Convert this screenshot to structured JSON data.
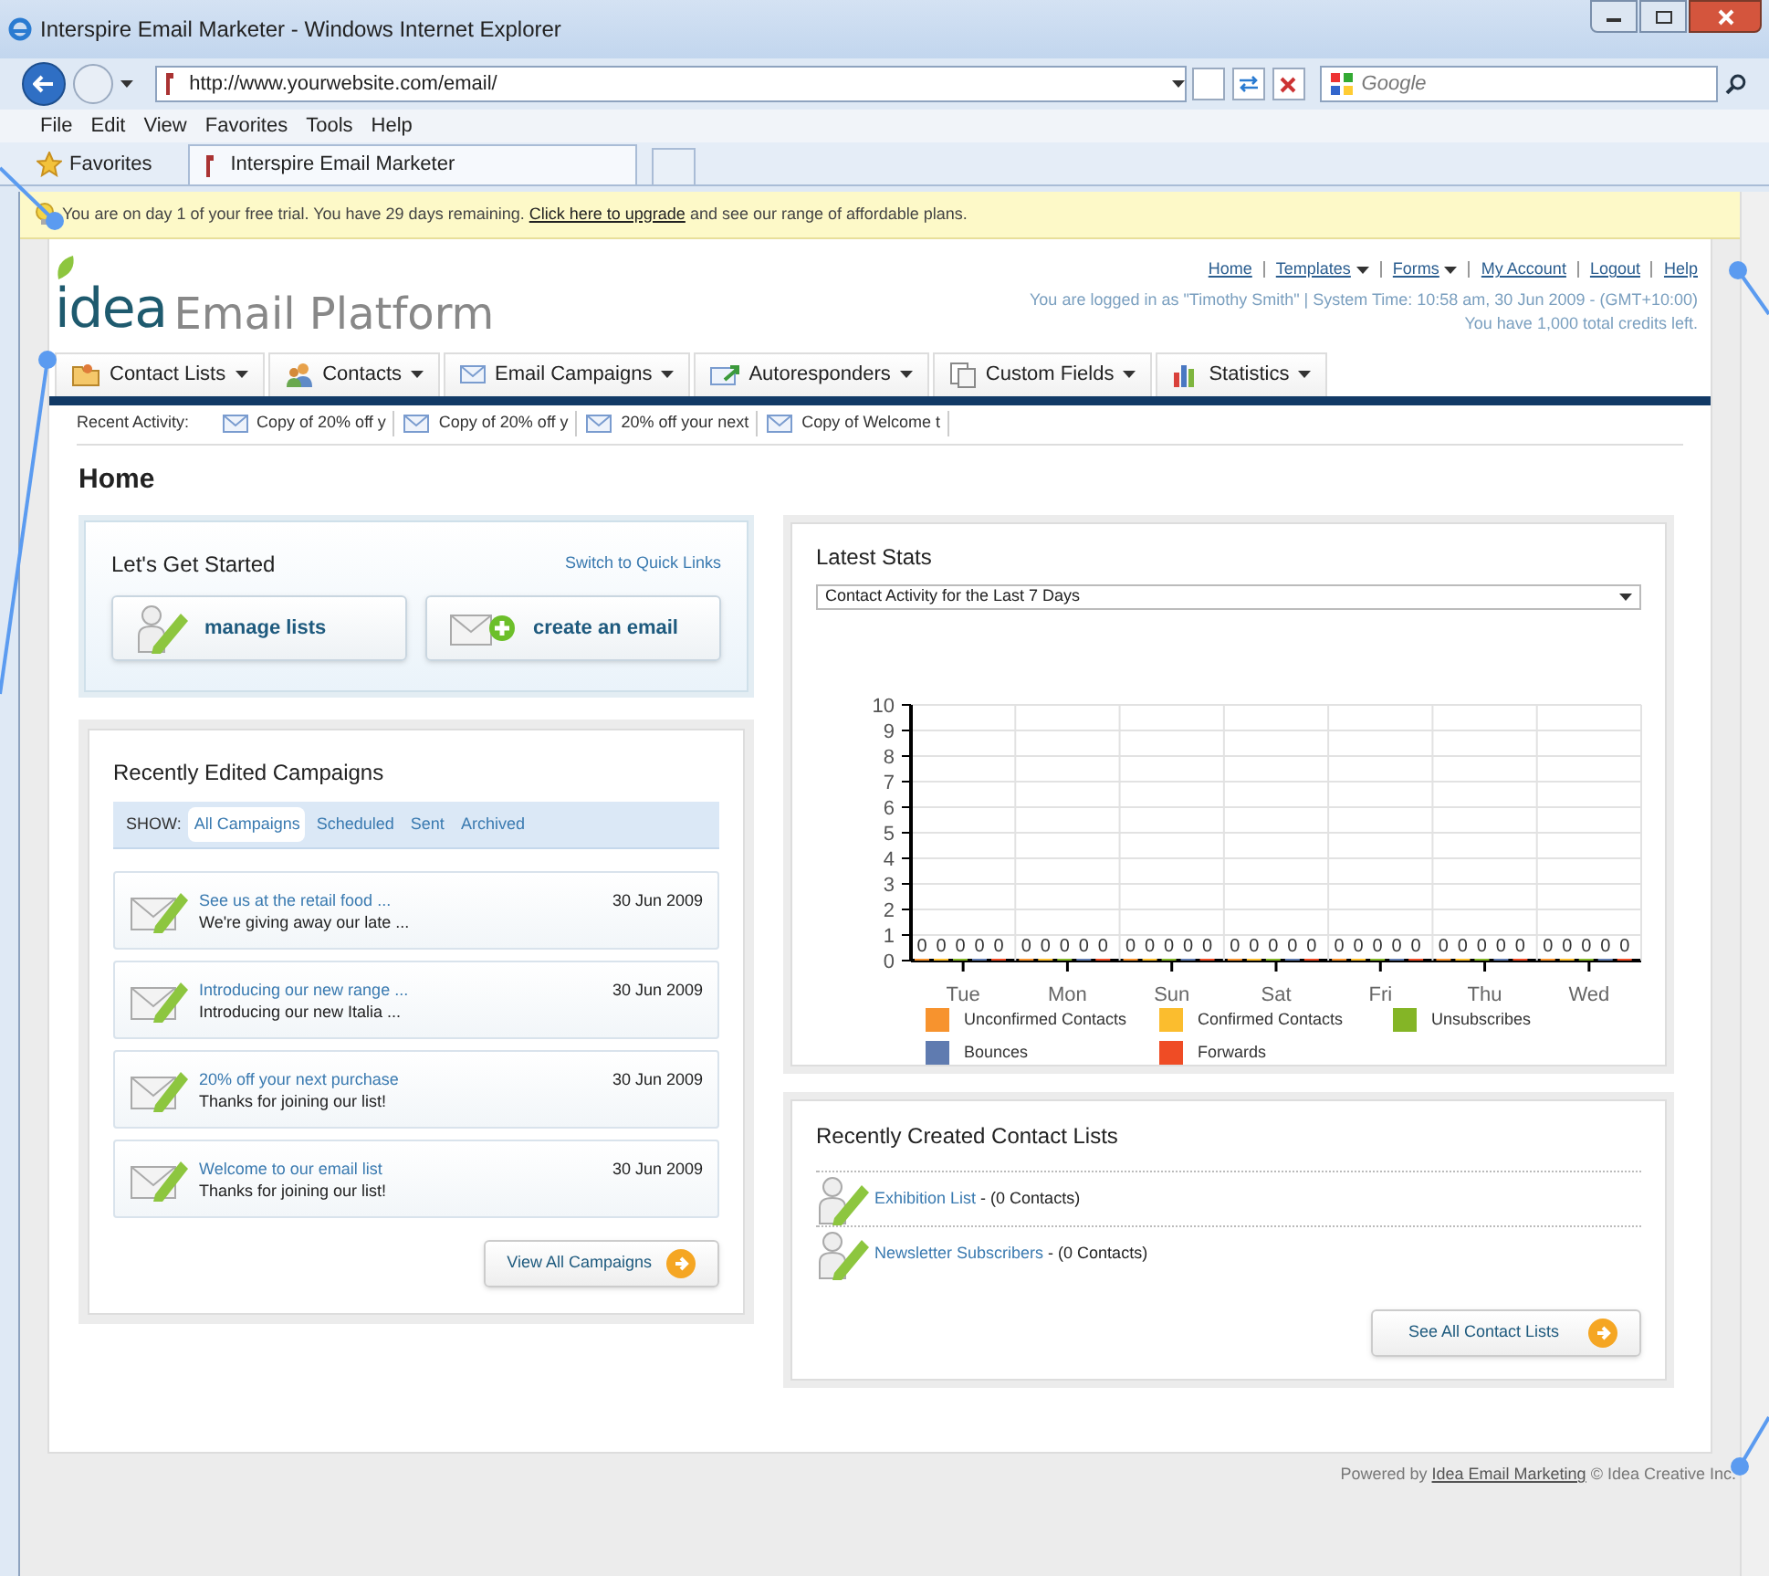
{
  "browser": {
    "title": "Interspire Email Marketer - Windows Internet Explorer",
    "address": "http://www.yourwebsite.com/email/",
    "search_placeholder": "Google",
    "menu": [
      "File",
      "Edit",
      "View",
      "Favorites",
      "Tools",
      "Help"
    ],
    "favorites": "Favorites",
    "tab": "Interspire Email Marketer"
  },
  "trial_bar": {
    "before": "You are on day 1 of your free trial. You have 29 days remaining.",
    "link": "Click here to upgrade",
    "after": "and see our range of affordable plans."
  },
  "header": {
    "logo": {
      "brand": "idea",
      "product": "Email Platform"
    },
    "top_links": [
      {
        "label": "Home",
        "dropdown": false
      },
      {
        "label": "Templates",
        "dropdown": true
      },
      {
        "label": "Forms",
        "dropdown": true
      },
      {
        "label": "My Account",
        "dropdown": false
      },
      {
        "label": "Logout",
        "dropdown": false
      },
      {
        "label": "Help",
        "dropdown": false
      }
    ],
    "login_info": "You are logged in as \"Timothy Smith\" | System Time: 10:58 am, 30 Jun 2009 - (GMT+10:00)",
    "credits": "You have 1,000 total credits left."
  },
  "nav_tabs": [
    {
      "label": "Contact Lists"
    },
    {
      "label": "Contacts"
    },
    {
      "label": "Email Campaigns"
    },
    {
      "label": "Autoresponders"
    },
    {
      "label": "Custom Fields"
    },
    {
      "label": "Statistics"
    }
  ],
  "recent_activity": {
    "label": "Recent Activity:",
    "items": [
      "Copy of 20% off y",
      "Copy of 20% off y",
      "20% off your next",
      "Copy of Welcome t"
    ]
  },
  "page_title": "Home",
  "get_started": {
    "title": "Let's Get Started",
    "link": "Switch to Quick Links",
    "buttons": [
      "manage lists",
      "create an email"
    ]
  },
  "campaigns": {
    "title": "Recently Edited Campaigns",
    "show_label": "SHOW:",
    "filters": [
      {
        "label": "All Campaigns",
        "selected": true
      },
      {
        "label": "Scheduled",
        "selected": false
      },
      {
        "label": "Sent",
        "selected": false
      },
      {
        "label": "Archived",
        "selected": false
      }
    ],
    "items": [
      {
        "title": "See us at the retail food ...",
        "summary": "We're giving away our late ...",
        "date": "30 Jun 2009"
      },
      {
        "title": "Introducing our new range ...",
        "summary": "Introducing our new Italia ...",
        "date": "30 Jun 2009"
      },
      {
        "title": "20% off your next purchase",
        "summary": "Thanks for joining our list!",
        "date": "30 Jun 2009"
      },
      {
        "title": "Welcome to our email list",
        "summary": "Thanks for joining our list!",
        "date": "30 Jun 2009"
      }
    ],
    "view_all": "View All Campaigns"
  },
  "stats": {
    "title": "Latest Stats",
    "select": "Contact Activity for the Last 7 Days",
    "chart_data": {
      "type": "bar",
      "categories": [
        "Tue",
        "Mon",
        "Sun",
        "Sat",
        "Fri",
        "Thu",
        "Wed"
      ],
      "series": [
        {
          "name": "Unconfirmed Contacts",
          "color": "#f7932e",
          "values": [
            0,
            0,
            0,
            0,
            0,
            0,
            0
          ]
        },
        {
          "name": "Confirmed Contacts",
          "color": "#fbbd2e",
          "values": [
            0,
            0,
            0,
            0,
            0,
            0,
            0
          ]
        },
        {
          "name": "Unsubscribes",
          "color": "#84b526",
          "values": [
            0,
            0,
            0,
            0,
            0,
            0,
            0
          ]
        },
        {
          "name": "Bounces",
          "color": "#5f7bb0",
          "values": [
            0,
            0,
            0,
            0,
            0,
            0,
            0
          ]
        },
        {
          "name": "Forwards",
          "color": "#ef4c25",
          "values": [
            0,
            0,
            0,
            0,
            0,
            0,
            0
          ]
        }
      ],
      "ylim": [
        0,
        10
      ],
      "yticks": [
        0,
        1,
        2,
        3,
        4,
        5,
        6,
        7,
        8,
        9,
        10
      ],
      "data_labels": true,
      "grid": true,
      "legend": true
    }
  },
  "contact_lists": {
    "title": "Recently Created Contact Lists",
    "items": [
      {
        "name": "Exhibition List",
        "count": "- (0 Contacts)"
      },
      {
        "name": "Newsletter Subscribers",
        "count": "- (0 Contacts)"
      }
    ],
    "see_all": "See All Contact Lists"
  },
  "footer": {
    "before": "Powered by",
    "link": "Idea Email Marketing",
    "after": "© Idea Creative Inc."
  }
}
